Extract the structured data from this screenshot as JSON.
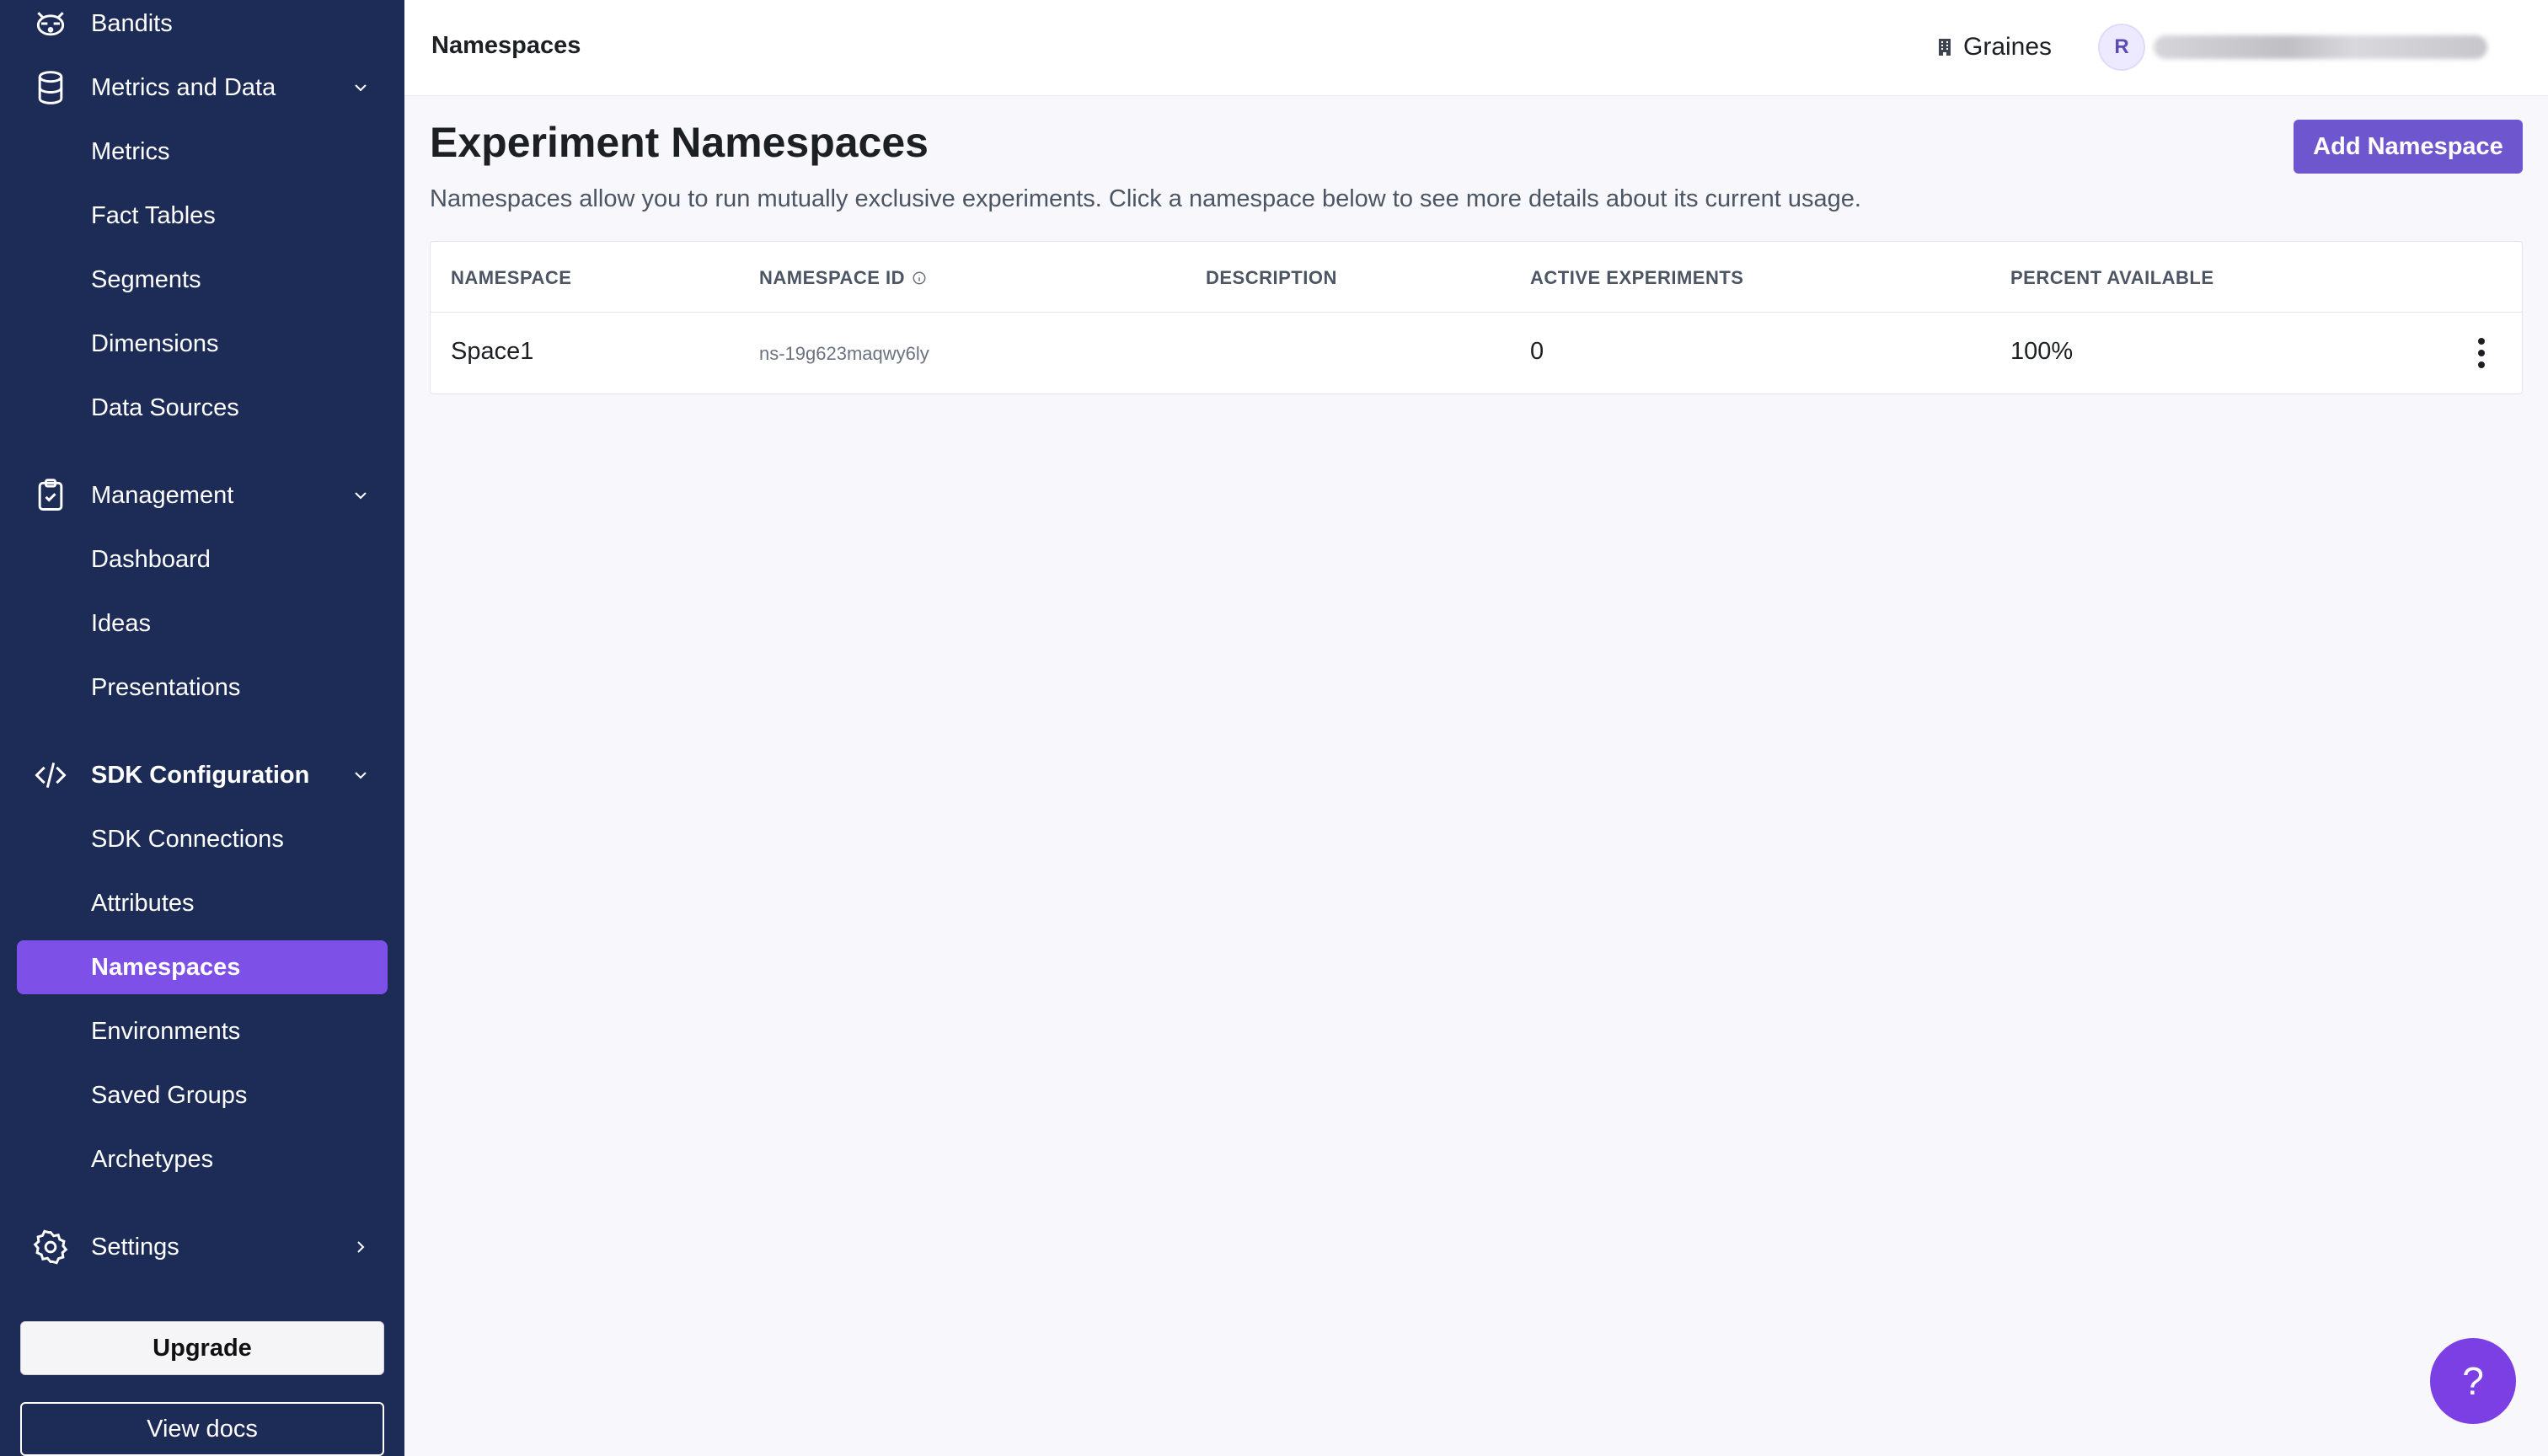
{
  "sidebar": {
    "top_item": {
      "label": "Bandits",
      "icon": "raccoon-icon"
    },
    "groups": {
      "metrics": {
        "label": "Metrics and Data",
        "icon": "database-icon"
      },
      "management": {
        "label": "Management",
        "icon": "clipboard-check-icon"
      },
      "sdk": {
        "label": "SDK Configuration",
        "icon": "code-icon"
      },
      "settings": {
        "label": "Settings",
        "icon": "gear-icon"
      }
    },
    "metrics_items": [
      "Metrics",
      "Fact Tables",
      "Segments",
      "Dimensions",
      "Data Sources"
    ],
    "management_items": [
      "Dashboard",
      "Ideas",
      "Presentations"
    ],
    "sdk_items": [
      "SDK Connections",
      "Attributes",
      "Namespaces",
      "Environments",
      "Saved Groups",
      "Archetypes"
    ],
    "active_item": "Namespaces",
    "upgrade_label": "Upgrade",
    "docs_label": "View docs"
  },
  "header": {
    "title": "Namespaces",
    "org_name": "Graines",
    "avatar_initial": "R"
  },
  "main": {
    "title": "Experiment Namespaces",
    "description": "Namespaces allow you to run mutually exclusive experiments. Click a namespace below to see more details about its current usage.",
    "add_button": "Add Namespace",
    "columns": [
      "NAMESPACE",
      "NAMESPACE ID",
      "DESCRIPTION",
      "ACTIVE EXPERIMENTS",
      "PERCENT AVAILABLE"
    ],
    "rows": [
      {
        "namespace": "Space1",
        "id": "ns-19g623maqwy6ly",
        "description": "",
        "active": "0",
        "percent": "100%"
      }
    ]
  },
  "help_label": "?",
  "colors": {
    "sidebar_bg": "#1d2b57",
    "accent": "#6e56cf",
    "active_nav": "#7d50e8"
  }
}
